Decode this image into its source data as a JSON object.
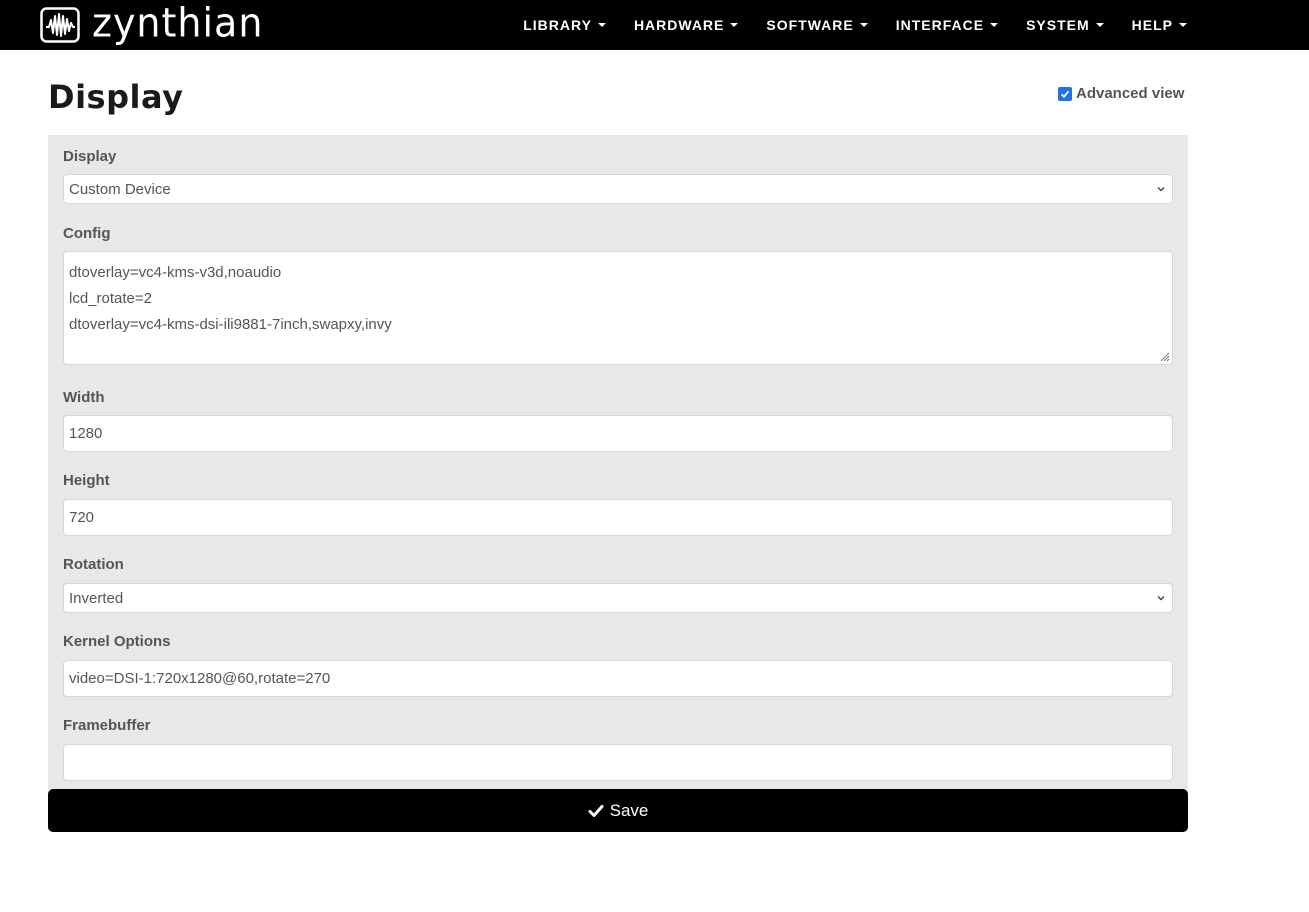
{
  "brand": {
    "name": "zynthian",
    "logo_icon": "waveform-logo-icon"
  },
  "nav": {
    "items": [
      {
        "label": "LIBRARY"
      },
      {
        "label": "HARDWARE"
      },
      {
        "label": "SOFTWARE"
      },
      {
        "label": "INTERFACE"
      },
      {
        "label": "SYSTEM"
      },
      {
        "label": "HELP"
      }
    ]
  },
  "page": {
    "title": "Display",
    "advanced_view": {
      "label": "Advanced view",
      "checked": true
    }
  },
  "form": {
    "display": {
      "label": "Display",
      "value": "Custom Device"
    },
    "config": {
      "label": "Config",
      "lines": [
        "dtoverlay=vc4-kms-v3d,noaudio",
        "lcd_rotate=2",
        "dtoverlay=vc4-kms-dsi-ili9881-7inch,swapxy,invy"
      ]
    },
    "width": {
      "label": "Width",
      "value": "1280"
    },
    "height": {
      "label": "Height",
      "value": "720"
    },
    "rotation": {
      "label": "Rotation",
      "value": "Inverted"
    },
    "kernel_options": {
      "label": "Kernel Options",
      "value": "video=DSI-1:720x1280@60,rotate=270"
    },
    "framebuffer": {
      "label": "Framebuffer",
      "value": ""
    }
  },
  "actions": {
    "save_label": "Save"
  },
  "colors": {
    "navbar": "#000000",
    "panel": "#e8e8e8",
    "checkbox": "#1a73e8",
    "save_button": "#000000"
  }
}
